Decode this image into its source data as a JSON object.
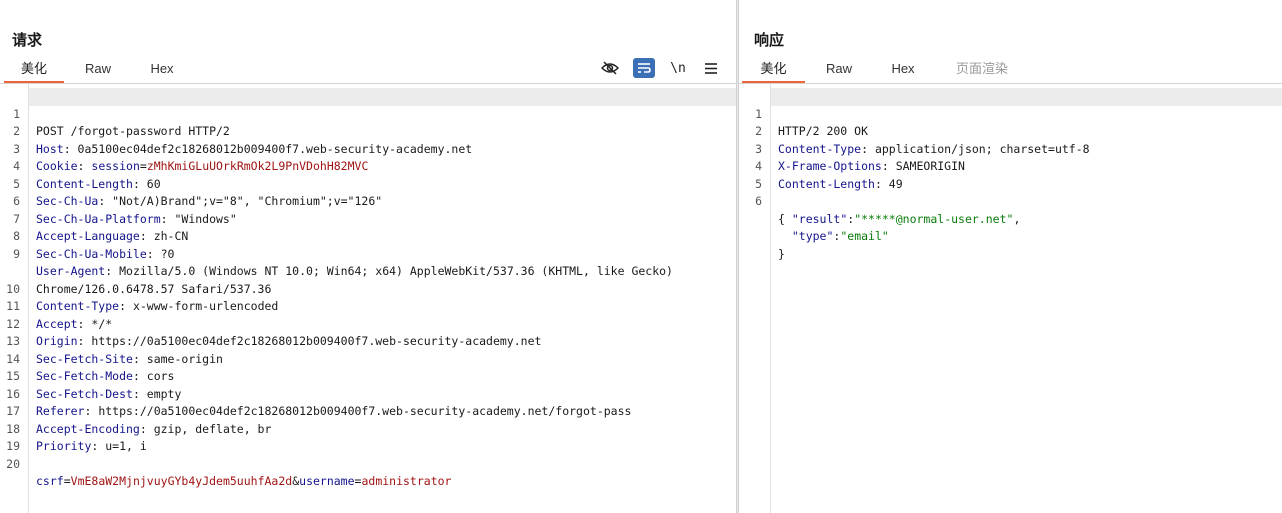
{
  "request": {
    "title": "请求",
    "tabs": [
      {
        "label": "美化",
        "active": true
      },
      {
        "label": "Raw",
        "active": false
      },
      {
        "label": "Hex",
        "active": false
      }
    ],
    "toolbar": {
      "newline_label": "\\n"
    },
    "lines": {
      "l1": {
        "num": "1",
        "text": "POST /forgot-password HTTP/2"
      },
      "l2": {
        "num": "2",
        "key": "Host",
        "value": ": 0a5100ec04def2c18268012b009400f7.web-security-academy.net"
      },
      "l3": {
        "num": "3",
        "key": "Cookie",
        "sep": ": ",
        "ckey": "session",
        "eq": "=",
        "cval": "zMhKmiGLuUOrkRmOk2L9PnVDohH82MVC"
      },
      "l4": {
        "num": "4",
        "key": "Content-Length",
        "value": ": 60"
      },
      "l5": {
        "num": "5",
        "key": "Sec-Ch-Ua",
        "value": ": \"Not/A)Brand\";v=\"8\", \"Chromium\";v=\"126\""
      },
      "l6": {
        "num": "6",
        "key": "Sec-Ch-Ua-Platform",
        "value": ": \"Windows\""
      },
      "l7": {
        "num": "7",
        "key": "Accept-Language",
        "value": ": zh-CN"
      },
      "l8": {
        "num": "8",
        "key": "Sec-Ch-Ua-Mobile",
        "value": ": ?0"
      },
      "l9": {
        "num": "9",
        "key": "User-Agent",
        "value": ": Mozilla/5.0 (Windows NT 10.0; Win64; x64) AppleWebKit/537.36 (KHTML, like Gecko) Chrome/126.0.6478.57 Safari/537.36"
      },
      "l10": {
        "num": "10",
        "key": "Content-Type",
        "value": ": x-www-form-urlencoded"
      },
      "l11": {
        "num": "11",
        "key": "Accept",
        "value": ": */*"
      },
      "l12": {
        "num": "12",
        "key": "Origin",
        "value": ": https://0a5100ec04def2c18268012b009400f7.web-security-academy.net"
      },
      "l13": {
        "num": "13",
        "key": "Sec-Fetch-Site",
        "value": ": same-origin"
      },
      "l14": {
        "num": "14",
        "key": "Sec-Fetch-Mode",
        "value": ": cors"
      },
      "l15": {
        "num": "15",
        "key": "Sec-Fetch-Dest",
        "value": ": empty"
      },
      "l16": {
        "num": "16",
        "key": "Referer",
        "value": ": https://0a5100ec04def2c18268012b009400f7.web-security-academy.net/forgot-pass"
      },
      "l17": {
        "num": "17",
        "key": "Accept-Encoding",
        "value": ": gzip, deflate, br"
      },
      "l18": {
        "num": "18",
        "key": "Priority",
        "value": ": u=1, i"
      },
      "l19": {
        "num": "19"
      },
      "l20": {
        "num": "20",
        "p1k": "csrf",
        "eq1": "=",
        "p1v": "VmE8aW2MjnjvuyGYb4yJdem5uuhfAa2d",
        "amp": "&",
        "p2k": "username",
        "eq2": "=",
        "p2v": "administrator"
      }
    }
  },
  "response": {
    "title": "响应",
    "tabs": [
      {
        "label": "美化",
        "active": true
      },
      {
        "label": "Raw",
        "active": false
      },
      {
        "label": "Hex",
        "active": false
      },
      {
        "label": "页面渲染",
        "active": false
      }
    ],
    "lines": {
      "l1": {
        "num": "1",
        "text": "HTTP/2 200 OK"
      },
      "l2": {
        "num": "2",
        "key": "Content-Type",
        "value": ": application/json; charset=utf-8"
      },
      "l3": {
        "num": "3",
        "key": "X-Frame-Options",
        "value": ": SAMEORIGIN"
      },
      "l4": {
        "num": "4",
        "key": "Content-Length",
        "value": ": 49"
      },
      "l5": {
        "num": "5"
      },
      "l6": {
        "num": "6",
        "text": "{"
      },
      "l7": {
        "indent": "  ",
        "key": "\"result\"",
        "colon": ":",
        "value": "\"*****@normal-user.net\"",
        "comma": ","
      },
      "l8": {
        "indent": "  ",
        "key": "\"type\"",
        "colon": ":",
        "value": "\"email\""
      },
      "l9": {
        "text": "}"
      }
    }
  }
}
